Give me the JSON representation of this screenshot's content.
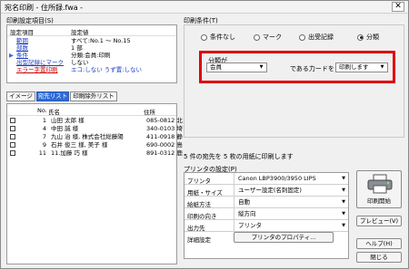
{
  "window": {
    "title": "宛名印刷 - 住所録.fwa -",
    "close_label": "✕"
  },
  "settings": {
    "label": "印刷設定項目(S)",
    "col_item": "設定項目",
    "col_value": "設定値",
    "rows": [
      {
        "item": "範囲",
        "value": "すべて:No.1 ～ No.15"
      },
      {
        "item": "部数",
        "value": "1 部"
      },
      {
        "item": "条件",
        "value": "分類:会員:印刷"
      },
      {
        "item": "出型記録にマーク",
        "value": "しない"
      },
      {
        "item": "エラー字置印刷",
        "value": "エコ:しない うず置:しない"
      }
    ]
  },
  "tabs": {
    "image": "イメージ",
    "list": "宛先リスト",
    "excluded": "印刷除外リスト"
  },
  "list": {
    "headers": {
      "no": "No.",
      "name": "氏名",
      "address": "住所"
    },
    "rows": [
      {
        "no": "1",
        "name": "山田 太郎 様",
        "address": "085-0812 北"
      },
      {
        "no": "4",
        "name": "中田 誠 様",
        "address": "340-0103 埼"
      },
      {
        "no": "7",
        "name": "九山 治 様, 株式会社総藤陽",
        "address": "411-0918 静"
      },
      {
        "no": "9",
        "name": "石井 俊三 様, 美子 様",
        "address": "690-0002 島"
      },
      {
        "no": "11",
        "name": "11.加藤 巧 様",
        "address": "891-0312 鹿"
      }
    ]
  },
  "conditions": {
    "label": "印刷条件(T)",
    "radios": [
      "条件なし",
      "マーク",
      "出受記録",
      "分類"
    ],
    "selected": "分類",
    "category_label": "分類が",
    "category_value": "会員",
    "middle_text": "である力ードを",
    "action_value": "印刷します"
  },
  "summary": "5 件の宛先を 5 枚の用紙に印刷します",
  "printer": {
    "label": "プリンタの設定(P)",
    "rows": [
      {
        "key": "プリンタ",
        "value": "Canon LBP3900/3950 LIPS"
      },
      {
        "key": "用紙・サイズ",
        "value": "ユーザー設定(名刺固定)"
      },
      {
        "key": "給紙方法",
        "value": "自動"
      },
      {
        "key": "印刷の向き",
        "value": "縦方向"
      },
      {
        "key": "出力先",
        "value": "プリンタ"
      }
    ],
    "detail_label": "詳細設定",
    "properties_button": "プリンタのプロパティ..."
  },
  "buttons": {
    "print": "印刷開始",
    "preview": "プレビュー(V)",
    "help": "ヘルプ(H)",
    "close": "閉じる"
  },
  "colors": {
    "highlight": "#e0000f",
    "active_tab": "#2e6bd8",
    "link": "#1a3cc0"
  }
}
